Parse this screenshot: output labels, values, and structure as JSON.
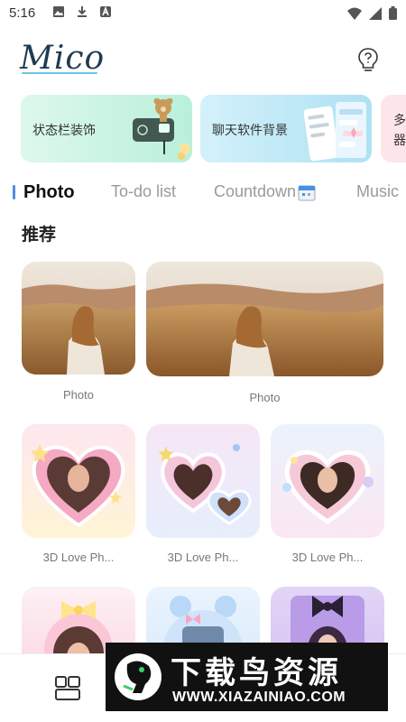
{
  "status_bar": {
    "time": "5:16",
    "icons": [
      "image-icon",
      "download-icon",
      "a-icon"
    ],
    "right_icons": [
      "wifi-icon",
      "signal-icon",
      "battery-icon"
    ]
  },
  "header": {
    "logo_text": "Mico",
    "help_icon": "lightbulb-help-icon"
  },
  "banners": [
    {
      "label": "状态栏装饰"
    },
    {
      "label": "聊天软件背景"
    },
    {
      "label": "多器"
    }
  ],
  "tabs": [
    {
      "label": "Photo",
      "active": true
    },
    {
      "label": "To-do list",
      "active": false
    },
    {
      "label": "Countdown",
      "active": false
    },
    {
      "label": "Music",
      "active": false
    }
  ],
  "section_title": "推荐",
  "recommend": [
    {
      "label": "Photo"
    },
    {
      "label": "Photo"
    }
  ],
  "love_frames": [
    {
      "label": "3D Love Ph..."
    },
    {
      "label": "3D Love Ph..."
    },
    {
      "label": "3D Love Ph..."
    }
  ],
  "watermark": {
    "title": "下载鸟资源",
    "url": "WWW.XIAZAINIAO.COM"
  },
  "colors": {
    "accent": "#4a90e2",
    "logo": "#1f3b52"
  }
}
